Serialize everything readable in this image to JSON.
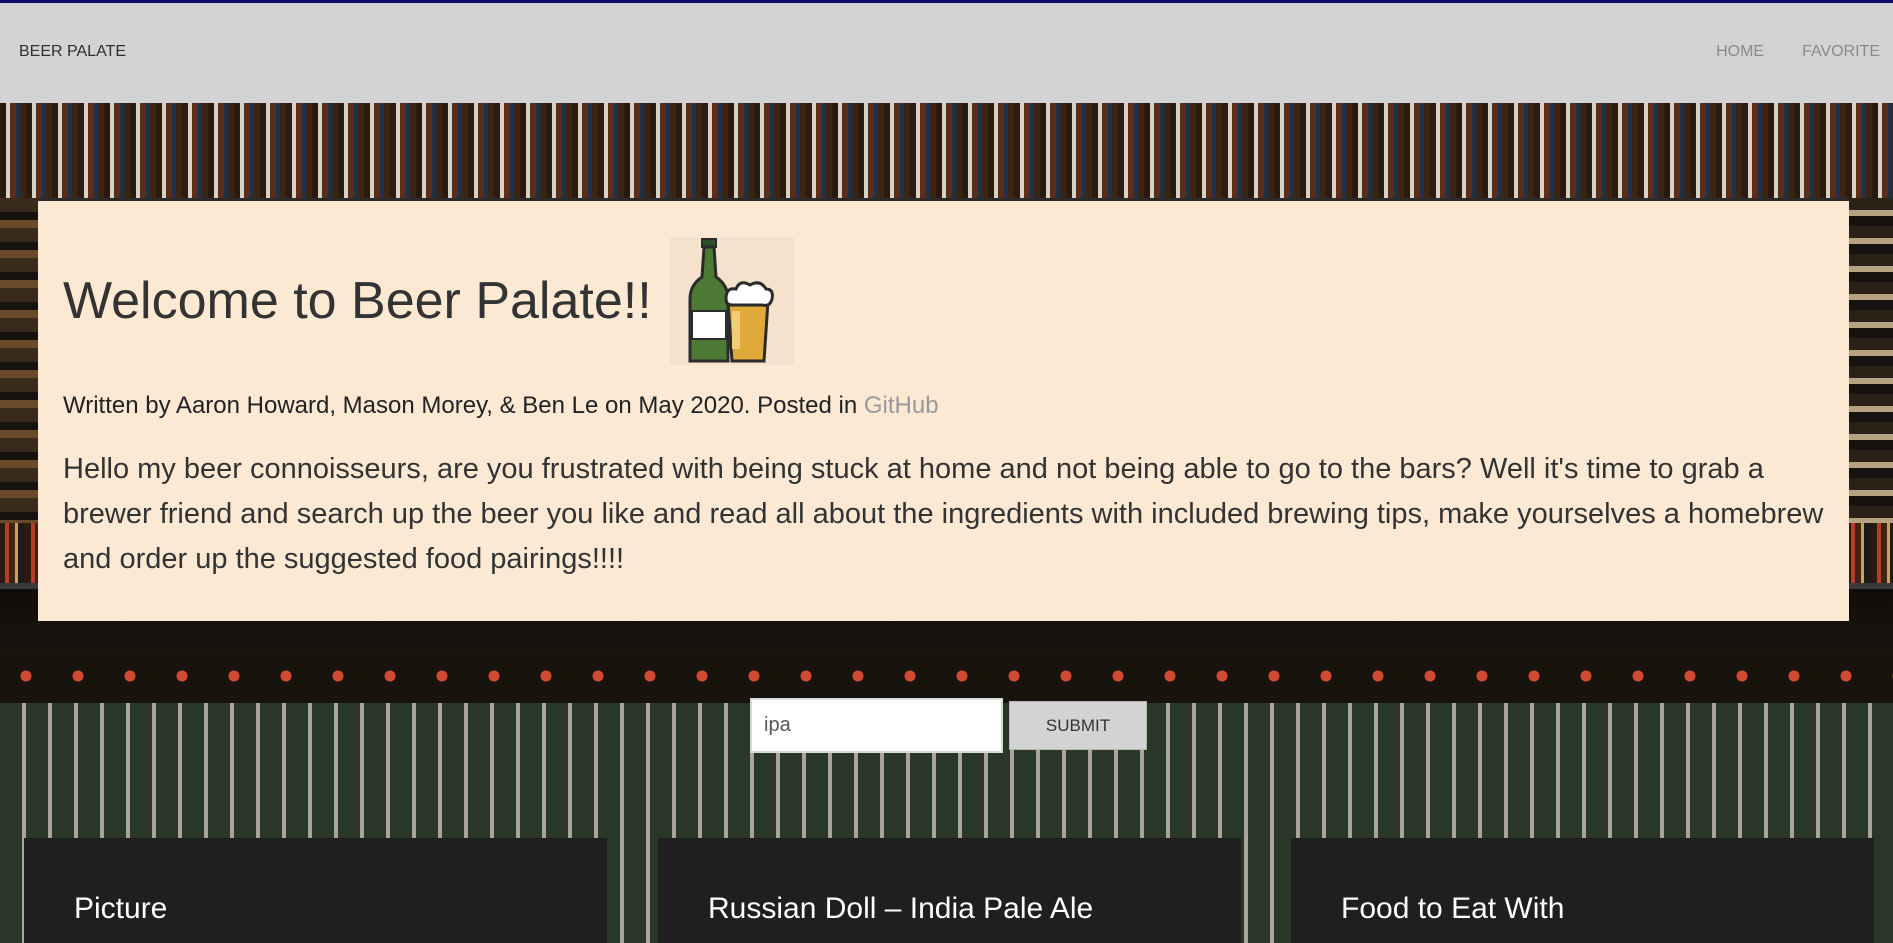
{
  "nav": {
    "brand": "BEER PALATE",
    "links": [
      {
        "label": "HOME"
      },
      {
        "label": "FAVORITE"
      }
    ]
  },
  "welcome": {
    "title": "Welcome to Beer Palate!!",
    "logo_icon": "beer-bottle-and-glass-icon",
    "byline_prefix": "Written by Aaron Howard, Mason Morey, & Ben Le on May 2020. Posted in ",
    "byline_link": "GitHub",
    "intro": "Hello my beer connoisseurs, are you frustrated with being stuck at home and not being able to go to the bars? Well it's time to grab a brewer friend and search up the beer you like and read all about the ingredients with included brewing tips, make yourselves a homebrew and order up the suggested food pairings!!!!"
  },
  "search": {
    "value": "ipa",
    "submit_label": "SUBMIT"
  },
  "panels": [
    {
      "title": "Picture"
    },
    {
      "title": "Russian Doll – India Pale Ale"
    },
    {
      "title": "Food to Eat With"
    }
  ],
  "colors": {
    "topbar": "#d3d3d3",
    "card": "#fbe9d4",
    "panel": "#1f1f1f",
    "topbar_accent": "#0a0f6b"
  }
}
